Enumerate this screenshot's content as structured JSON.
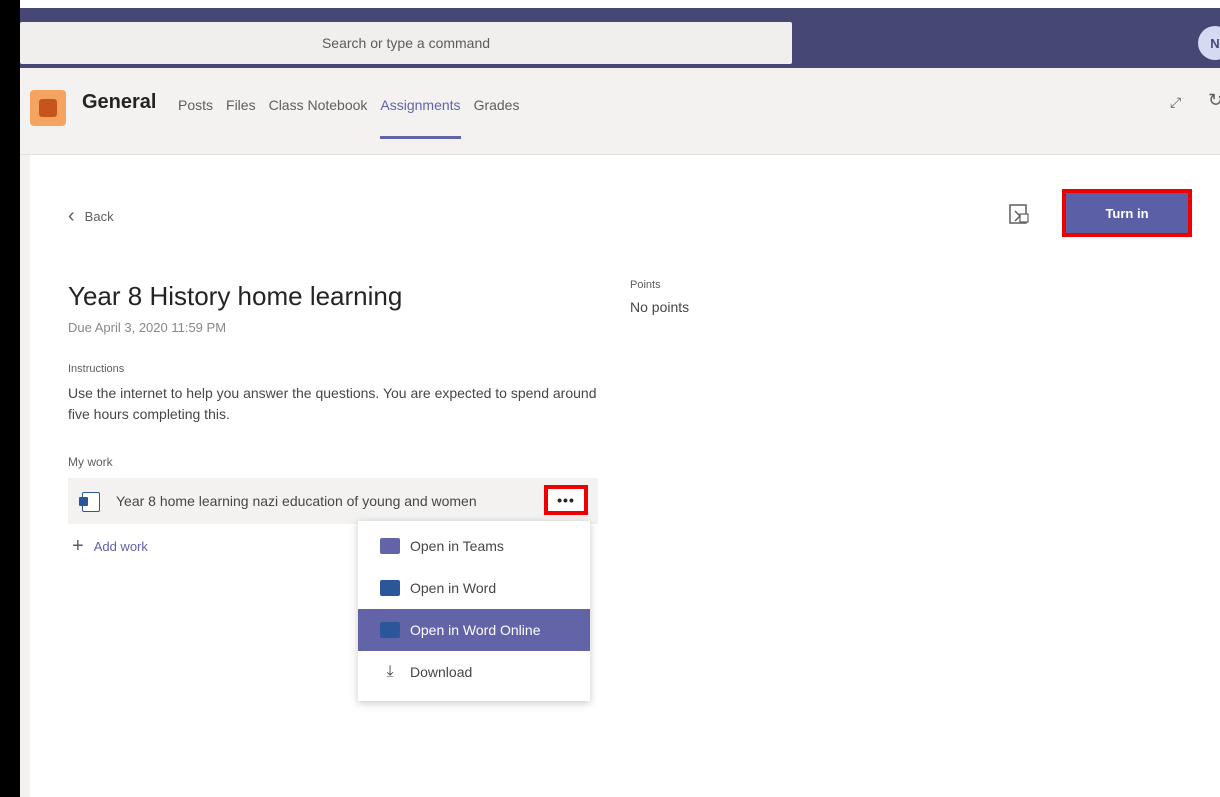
{
  "search": {
    "placeholder": "Search or type a command"
  },
  "user": {
    "initials": "N"
  },
  "channel": {
    "name": "General",
    "tabs": [
      {
        "label": "Posts"
      },
      {
        "label": "Files"
      },
      {
        "label": "Class Notebook"
      },
      {
        "label": "Assignments"
      },
      {
        "label": "Grades"
      }
    ],
    "active_tab": "Assignments"
  },
  "assignment": {
    "back_label": "Back",
    "turn_in_label": "Turn in",
    "title": "Year 8 History home learning",
    "due": "Due April 3, 2020 11:59 PM",
    "instructions_label": "Instructions",
    "instructions": "Use the internet to help you answer the questions. You are expected to spend around five hours completing this.",
    "my_work_label": "My work",
    "file_name": "Year 8 home learning nazi education of young and women",
    "more_label": "•••",
    "add_work_label": "Add work",
    "points_label": "Points",
    "points_value": "No points"
  },
  "menu": {
    "items": [
      {
        "label": "Open in Teams",
        "icon": "teams-icon"
      },
      {
        "label": "Open in Word",
        "icon": "word-icon"
      },
      {
        "label": "Open in Word Online",
        "icon": "word-icon",
        "selected": true
      },
      {
        "label": "Download",
        "icon": "download-icon"
      }
    ]
  },
  "colors": {
    "titlebar": "#464775",
    "accent": "#6264a7",
    "highlight_box": "#e00000"
  }
}
